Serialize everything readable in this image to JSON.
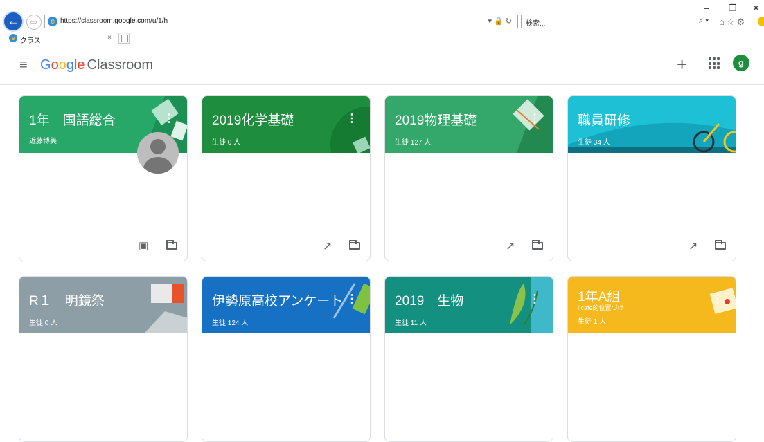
{
  "browser": {
    "back": "←",
    "forward": "⇨",
    "url_prefix": "https://classroom.",
    "url_domain": "google.com",
    "url_suffix": "/u/1/h",
    "address_controls": "▾ 🔒 ↻",
    "search_placeholder": "検索...",
    "search_btn": "⌕ ▾",
    "min": "–",
    "restore": "❐",
    "close": "✕",
    "toolbar_icons": "⌂☆⚙",
    "tab_title": "クラス",
    "tab_close": "×"
  },
  "app": {
    "logo_g": "G",
    "logo_o1": "o",
    "logo_o2": "o",
    "logo_g2": "g",
    "logo_l": "l",
    "logo_e": "e",
    "logo_rest": "Classroom",
    "menu": "≡",
    "plus": "+",
    "avatar": "g"
  },
  "classes": [
    {
      "title": "1年　国語総合",
      "sub": "近藤博美",
      "more": "⋮",
      "footer": [
        "portrait",
        "folder"
      ],
      "color": "#27a869"
    },
    {
      "title": "2019化学基礎",
      "sub": "生徒 0 人",
      "more": "⋮",
      "footer": [
        "trending",
        "folder"
      ],
      "color": "#1e8e3e"
    },
    {
      "title": "2019物理基礎",
      "sub": "生徒 127 人",
      "more": "⋮",
      "footer": [
        "trending",
        "folder"
      ],
      "color": "#33a86a"
    },
    {
      "title": "職員研修",
      "sub": "生徒 34 人",
      "more": "⋮",
      "footer": [
        "trending",
        "folder"
      ],
      "color": "#1ec0d6"
    },
    {
      "title": "R１　明鏡祭",
      "sub": "生徒 0 人",
      "more": "",
      "footer": [],
      "color": "#8d9ea6"
    },
    {
      "title": "伊勢原高校アンケート",
      "sub": "生徒 124 人",
      "more": "⋮",
      "footer": [],
      "color": "#1670c4"
    },
    {
      "title": "2019　生物",
      "sub": "生徒 11 人",
      "more": "⋮",
      "footer": [],
      "color": "#139080"
    },
    {
      "title": "1年A組",
      "sub": "生徒 1 人",
      "extra": "i cafe的位置づけ",
      "more": "⋮",
      "footer": [],
      "color": "#f5b91d"
    }
  ],
  "icons": {
    "portrait": "portrait-icon",
    "trending": "trending-up-icon",
    "folder": "folder-icon"
  }
}
